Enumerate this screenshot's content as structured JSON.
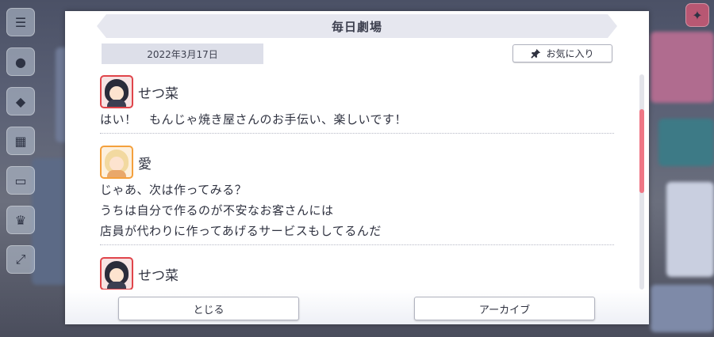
{
  "dialog": {
    "title": "毎日劇場",
    "date": "2022年3月17日",
    "favorite_label": "お気に入り"
  },
  "messages": [
    {
      "speaker": "せつ菜",
      "avatar_icon": "setsuna-avatar-icon",
      "lines": [
        "はい！　もんじゃ焼き屋さんのお手伝い、楽しいです！"
      ]
    },
    {
      "speaker": "愛",
      "avatar_icon": "ai-avatar-icon",
      "lines": [
        "じゃあ、次は作ってみる？",
        "うちは自分で作るのが不安なお客さんには",
        "店員が代わりに作ってあげるサービスもしてるんだ"
      ]
    },
    {
      "speaker": "せつ菜",
      "avatar_icon": "setsuna-avatar-icon",
      "lines": []
    }
  ],
  "footer": {
    "close_label": "とじる",
    "archive_label": "アーカイブ"
  },
  "scroll": {
    "thumb_position_fraction": 0.16,
    "thumb_size_fraction": 0.39
  },
  "colors": {
    "accent_scroll": "#ef7685",
    "setsuna_frame": "#e0444a",
    "ai_frame": "#f4a03c",
    "title_bar": "#e6e7ef"
  }
}
